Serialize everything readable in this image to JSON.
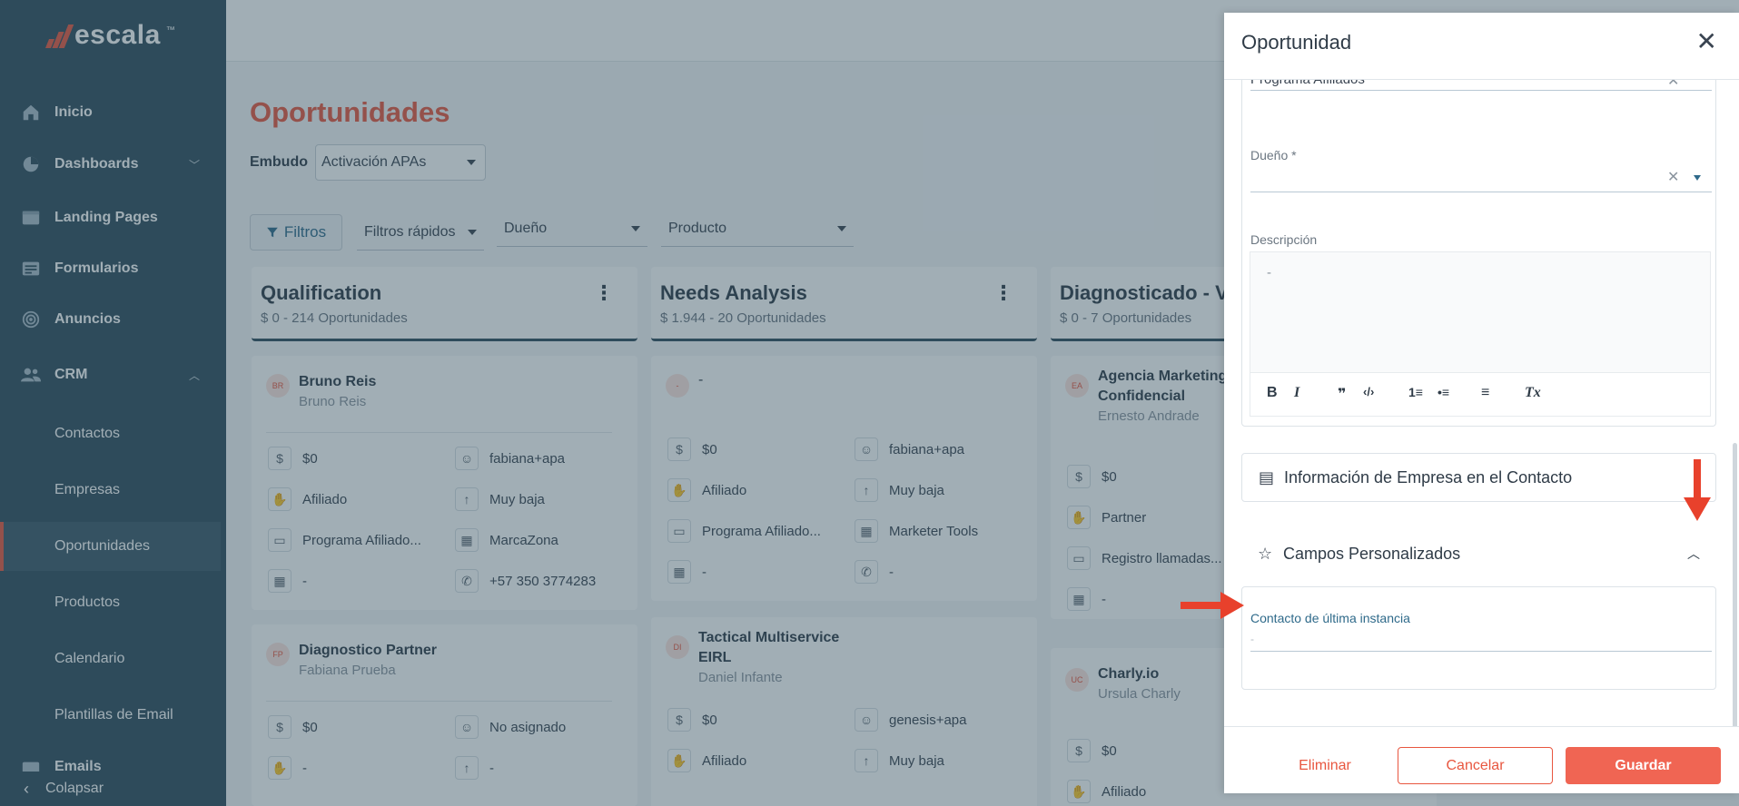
{
  "sidebar": {
    "brand": "escala",
    "brand_tm": "™",
    "items": [
      {
        "label": "Inicio"
      },
      {
        "label": "Dashboards"
      },
      {
        "label": "Landing Pages"
      },
      {
        "label": "Formularios"
      },
      {
        "label": "Anuncios"
      },
      {
        "label": "CRM"
      }
    ],
    "crm_sub": [
      {
        "label": "Contactos"
      },
      {
        "label": "Empresas"
      },
      {
        "label": "Oportunidades"
      },
      {
        "label": "Productos"
      },
      {
        "label": "Calendario"
      },
      {
        "label": "Plantillas de Email"
      },
      {
        "label": "Emails"
      }
    ],
    "collapse_label": "Colapsar"
  },
  "main": {
    "page_title": "Oportunidades",
    "embudo_label": "Embudo",
    "embudo_value": "Activación APAs",
    "filters_label": "Filtros",
    "quick_filters": "Filtros rápidos",
    "owner_filter": "Dueño",
    "product_filter": "Producto",
    "columns": [
      {
        "title": "Qualification",
        "subtitle": "$ 0 - 214 Oportunidades",
        "cards": [
          {
            "initials": "BR",
            "name": "Bruno Reis",
            "sub": "Bruno Reis",
            "fields": [
              "$0",
              "fabiana+apa",
              "Afiliado",
              "Muy baja",
              "Programa Afiliado...",
              "MarcaZona",
              "-",
              "+57 350 3774283"
            ]
          },
          {
            "initials": "FP",
            "name": "Diagnostico Partner",
            "sub": "Fabiana Prueba",
            "fields": [
              "$0",
              "No asignado",
              "-",
              "-"
            ]
          }
        ]
      },
      {
        "title": "Needs Analysis",
        "subtitle": "$ 1.944 - 20 Oportunidades",
        "cards": [
          {
            "initials": "-",
            "name": "-",
            "sub": "",
            "fields": [
              "$0",
              "fabiana+apa",
              "Afiliado",
              "Muy baja",
              "Programa Afiliado...",
              "Marketer Tools",
              "-",
              "-"
            ]
          },
          {
            "initials": "DI",
            "name": "Tactical Multiservice EIRL",
            "sub": "Daniel Infante",
            "fields": [
              "$0",
              "genesis+apa",
              "Afiliado",
              "Muy baja"
            ]
          }
        ]
      },
      {
        "title": "Diagnosticado - V",
        "subtitle": "$ 0 - 7 Oportunidades",
        "cards": [
          {
            "initials": "EA",
            "name": "Agencia Marketing Confidencial",
            "sub": "Ernesto Andrade",
            "fields": [
              "$0",
              "Partner",
              "Registro llamadas...",
              "-"
            ]
          },
          {
            "initials": "UC",
            "name": "Charly.io",
            "sub": "Ursula Charly",
            "fields": [
              "$0",
              "Afiliado"
            ]
          }
        ]
      }
    ]
  },
  "panel": {
    "title": "Oportunidad",
    "top_value": "Programa Afiliados",
    "owner_label": "Dueño *",
    "owner_value": "",
    "description_label": "Descripción",
    "description_value": "-",
    "toolbar": {
      "bold": "B",
      "italic": "I",
      "quote": "❞",
      "code": "‹/›",
      "ol": "1≡",
      "ul": "•≡",
      "align": "≡",
      "clear": "Tx"
    },
    "company_section": "Información de Empresa en el Contacto",
    "custom_section": "Campos Personalizados",
    "custom_field_label": "Contacto de última instancia",
    "custom_field_value": "-",
    "buttons": {
      "delete": "Eliminar",
      "cancel": "Cancelar",
      "save": "Guardar"
    }
  },
  "colors": {
    "sidebar": "#2f4b5c",
    "accent": "#e8563f",
    "save_button": "#f06553",
    "annotation_arrow": "#e8412c"
  }
}
